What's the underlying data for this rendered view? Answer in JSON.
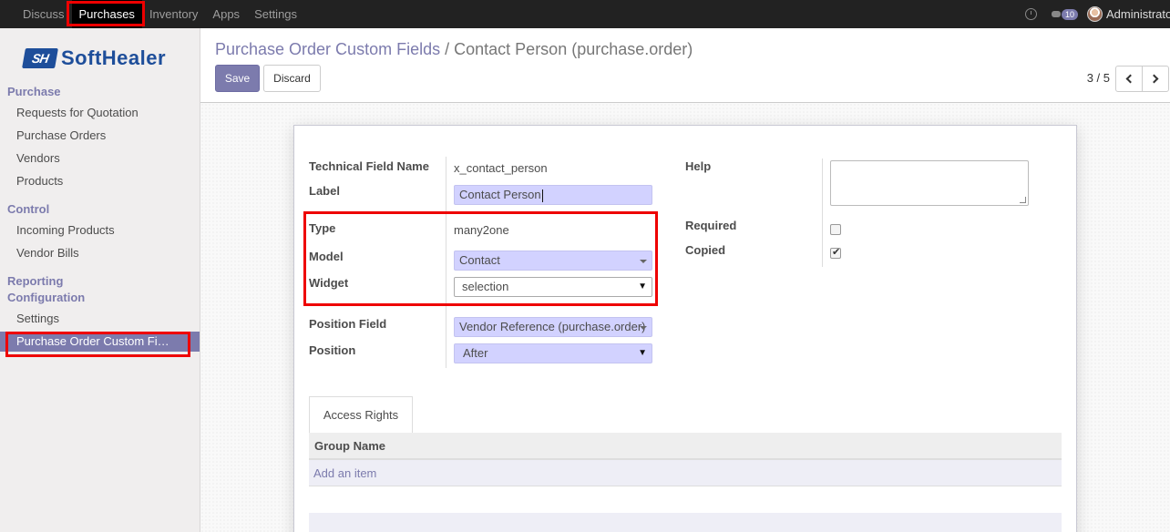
{
  "topnav": {
    "items": [
      "Discuss",
      "Purchases",
      "Inventory",
      "Apps",
      "Settings"
    ],
    "active": "Purchases",
    "chat_count": "10",
    "user": "Administrator"
  },
  "logo": {
    "mark": "SH",
    "text": "SoftHealer"
  },
  "sidebar": {
    "sections": [
      {
        "title": "Purchase",
        "items": [
          "Requests for Quotation",
          "Purchase Orders",
          "Vendors",
          "Products"
        ]
      },
      {
        "title": "Control",
        "items": [
          "Incoming Products",
          "Vendor Bills"
        ]
      },
      {
        "title": "Reporting",
        "items": []
      },
      {
        "title": "Configuration",
        "items": [
          "Settings",
          "Purchase Order Custom Fields"
        ]
      }
    ],
    "active_item": "Purchase Order Custom Fields"
  },
  "breadcrumb": {
    "parent": "Purchase Order Custom Fields",
    "separator": "/",
    "current": "Contact Person (purchase.order)"
  },
  "buttons": {
    "save": "Save",
    "discard": "Discard"
  },
  "pager": {
    "value": "3 / 5"
  },
  "form": {
    "technical_field_name": {
      "label": "Technical Field Name",
      "value": "x_contact_person"
    },
    "field_label": {
      "label": "Label",
      "value": "Contact Person"
    },
    "type": {
      "label": "Type",
      "value": "many2one"
    },
    "model": {
      "label": "Model",
      "value": "Contact"
    },
    "widget": {
      "label": "Widget",
      "value": "selection"
    },
    "position_field": {
      "label": "Position Field",
      "value": "Vendor Reference (purchase.order)"
    },
    "position": {
      "label": "Position",
      "value": "After"
    },
    "help": {
      "label": "Help",
      "value": ""
    },
    "required": {
      "label": "Required",
      "checked": false
    },
    "copied": {
      "label": "Copied",
      "checked": true
    }
  },
  "tabs": [
    {
      "label": "Access Rights"
    }
  ],
  "access_table": {
    "column": "Group Name",
    "add_item": "Add an item"
  },
  "colors": {
    "accent": "#7c7bad",
    "topbar": "#222222",
    "highlight": "#e00000",
    "required_field": "#d2d2ff"
  }
}
